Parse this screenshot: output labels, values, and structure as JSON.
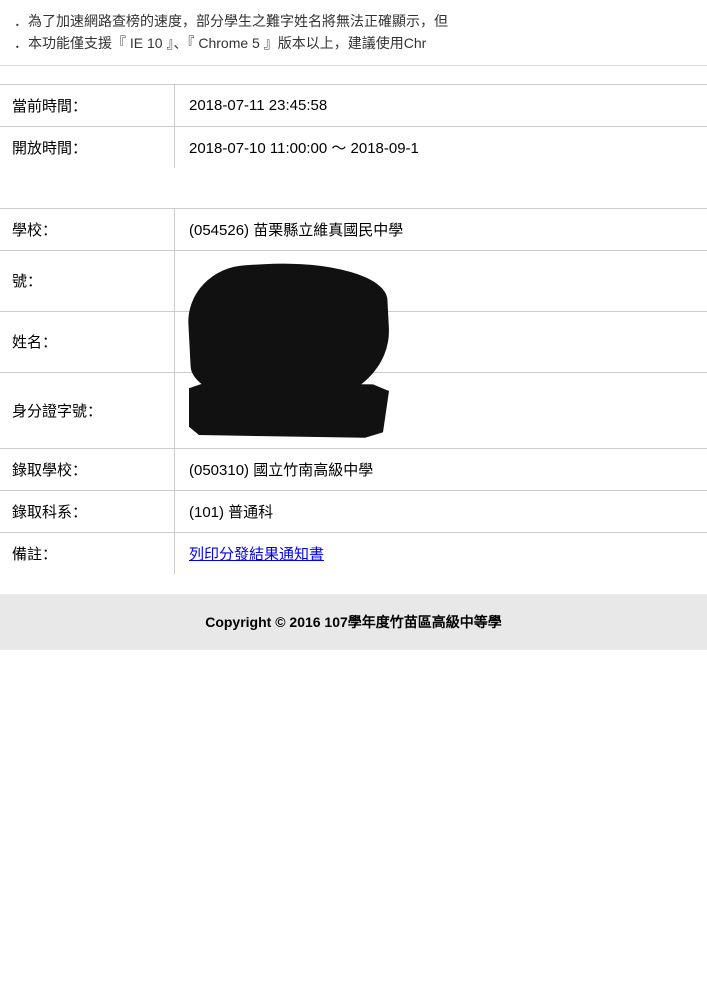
{
  "notice": {
    "line1": "．為了加速網路查榜的速度，部分學生之難字姓名將無法正確顯示，但",
    "line2": "．本功能僅支援『 IE 10 』、『 Chrome 5 』版本以上，建議使用Chr"
  },
  "time_section": {
    "current_time_label": "當前時間：",
    "current_time_value": "2018-07-11 23:45:58",
    "open_time_label": "開放時間：",
    "open_time_value": "2018-07-10 11:00:00 ～ 2018-09-1"
  },
  "student_section": {
    "school_label": "學校：",
    "school_value": "(054526) 苗栗縣立維真國民中學",
    "number_label": "號：",
    "name_label": "姓名：",
    "id_label": "身分證字號：",
    "admitted_school_label": "錄取學校：",
    "admitted_school_value": "(050310) 國立竹南高級中學",
    "admitted_dept_label": "錄取科系：",
    "admitted_dept_value": "(101) 普通科",
    "note_label": "備註：",
    "note_link_text": "列印分發結果通知書"
  },
  "footer": {
    "text": "Copyright © 2016 107學年度竹苗區高級中等學"
  }
}
